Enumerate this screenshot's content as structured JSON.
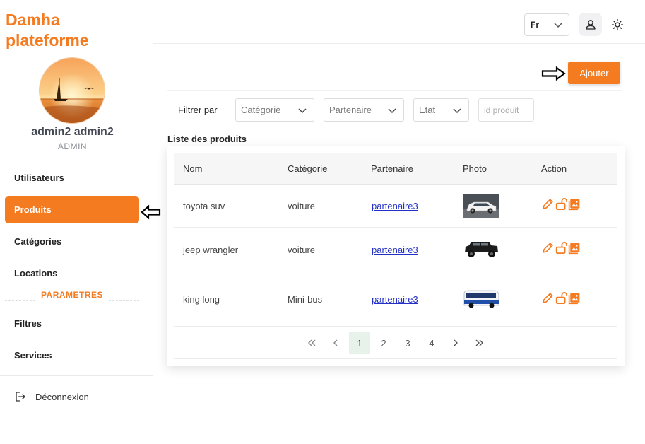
{
  "brand": {
    "line1": "Damha",
    "line2": "plateforme"
  },
  "user": {
    "name": "admin2 admin2",
    "role": "ADMIN"
  },
  "sidebar": {
    "items": [
      {
        "label": "Utilisateurs",
        "active": false
      },
      {
        "label": "Produits",
        "active": true
      },
      {
        "label": "Catégories",
        "active": false
      },
      {
        "label": "Locations",
        "active": false
      }
    ],
    "section_label": "PARAMETRES",
    "settings_items": [
      {
        "label": "Filtres"
      },
      {
        "label": "Services"
      }
    ],
    "logout_label": "Déconnexion"
  },
  "header": {
    "language": "Fr"
  },
  "toolbar": {
    "add_label": "Ajouter"
  },
  "filters": {
    "label": "Filtrer par",
    "category_placeholder": "Catégorie",
    "partner_placeholder": "Partenaire",
    "state_placeholder": "Etat",
    "id_placeholder": "id produit"
  },
  "list": {
    "title": "Liste des produits",
    "columns": [
      "Nom",
      "Catégorie",
      "Partenaire",
      "Photo",
      "Action"
    ],
    "rows": [
      {
        "name": "toyota suv",
        "category": "voiture",
        "partner": "partenaire3",
        "photo": "white-suv"
      },
      {
        "name": "jeep wrangler",
        "category": "voiture",
        "partner": "partenaire3",
        "photo": "black-jeep"
      },
      {
        "name": "king long",
        "category": "Mini-bus",
        "partner": "partenaire3",
        "photo": "blue-minibus"
      }
    ]
  },
  "pagination": {
    "pages": [
      "1",
      "2",
      "3",
      "4"
    ],
    "current": "1",
    "first": "«",
    "prev": "‹",
    "next": "›",
    "last": "»"
  },
  "colors": {
    "accent": "#f47b20",
    "link": "#2330c8",
    "active_page_bg": "#e7f3ea"
  }
}
